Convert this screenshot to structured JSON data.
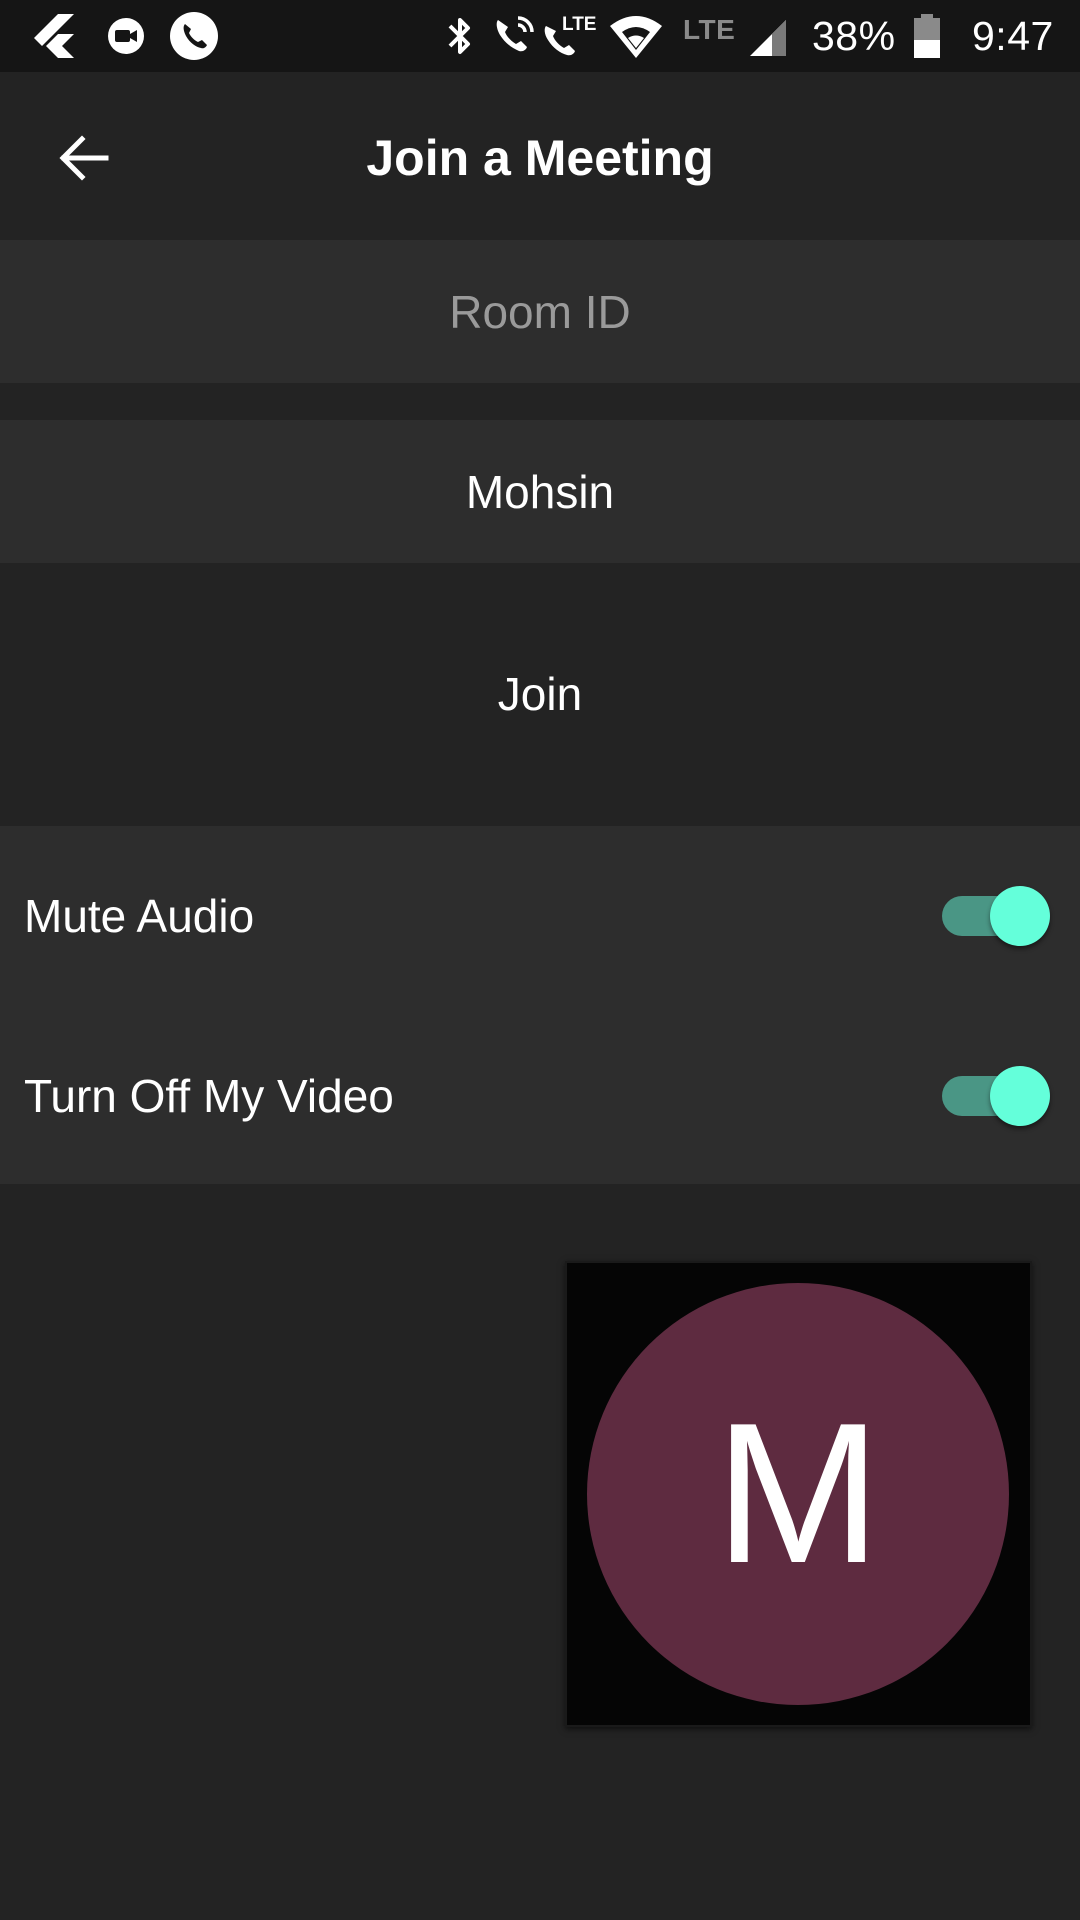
{
  "status_bar": {
    "battery": "38%",
    "time": "9:47",
    "network_label": "LTE",
    "icons": [
      "flutter-icon",
      "meet-icon",
      "phone-icon",
      "bluetooth-icon",
      "volte-call-icon",
      "lte-call-icon",
      "wifi-icon",
      "lte-icon",
      "signal-icon",
      "battery-icon"
    ]
  },
  "app_bar": {
    "title": "Join a Meeting",
    "back_icon": "arrow-back-icon"
  },
  "form": {
    "room_id": {
      "placeholder": "Room ID",
      "value": ""
    },
    "display_name": {
      "placeholder": "",
      "value": "Mohsin"
    },
    "join_label": "Join"
  },
  "options": [
    {
      "label": "Mute Audio",
      "enabled": true
    },
    {
      "label": "Turn Off My Video",
      "enabled": true
    }
  ],
  "preview": {
    "avatar_initial": "M"
  },
  "colors": {
    "background": "#232323",
    "surface": "#2d2d2d",
    "status_bar": "#151515",
    "toggle_thumb": "#64ffda",
    "toggle_track": "#4a9685",
    "avatar": "#5e2b40"
  }
}
